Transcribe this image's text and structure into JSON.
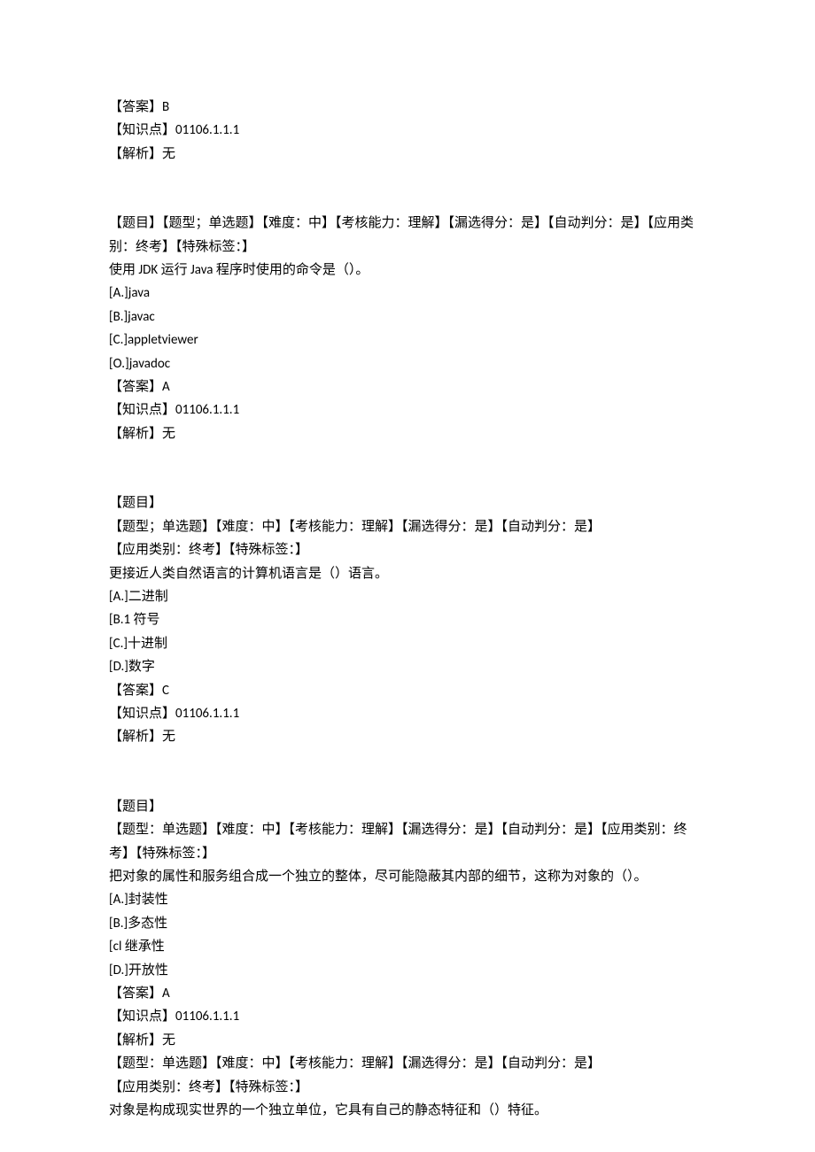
{
  "block1": {
    "answer_label": "【答案】",
    "answer_value": "B",
    "kp_label": "【知识点】",
    "kp_value": "01106.1.1.1",
    "exp_label": "【解析】",
    "exp_value": "无"
  },
  "block2": {
    "header": "【题目】【题型；单选题】【难度：中】【考核能力：理解】【漏选得分：是】【自动判分：是】【应用类别：终考】【特殊标签：】",
    "stem": "使用 JDK 运行 Java 程序时使用的命令是（）。",
    "optA": "[A.]java",
    "optB": "[B.]javac",
    "optC": "[C.]appletviewer",
    "optD": "[O.]javadoc",
    "answer_label": "【答案】",
    "answer_value": "A",
    "kp_label": "【知识点】",
    "kp_value": "01106.1.1.1",
    "exp_label": "【解析】",
    "exp_value": "无"
  },
  "block3": {
    "title": "【题目】",
    "tags1": "【题型；单选题】【难度：中】【考核能力：理解】【漏选得分：是】【自动判分：是】",
    "tags2": "【应用类别：终考】【特殊标签：】",
    "stem": "更接近人类自然语言的计算机语言是（）语言。",
    "optA": "[A.]二进制",
    "optB": "[B.1 符号",
    "optC": "[C.]十进制",
    "optD": "[D.]数字",
    "answer_label": "【答案】",
    "answer_value": "C",
    "kp_label": "【知识点】",
    "kp_value": "01106.1.1.1",
    "exp_label": "【解析】",
    "exp_value": "无"
  },
  "block4": {
    "title": "【题目】",
    "tags": "【题型：单选题】【难度：中】【考核能力：理解】【漏选得分：是】【自动判分：是】【应用类别：终考】【特殊标签：】",
    "stem": "把对象的属性和服务组合成一个独立的整体，尽可能隐蔽其内部的细节，这称为对象的（）。",
    "optA": "[A.]封装性",
    "optB": "[B.]多态性",
    "optC": "[cl 继承性",
    "optD": "[D.]开放性",
    "answer_label": "【答案】",
    "answer_value": "A",
    "kp_label": "【知识点】",
    "kp_value": "01106.1.1.1",
    "exp_label": "【解析】",
    "exp_value": "无"
  },
  "block5": {
    "tags1": "【题型：单选题】【难度：中】【考核能力：理解】【漏选得分：是】【自动判分：是】",
    "tags2": "【应用类别：终考】【特殊标签：】",
    "stem": "对象是构成现实世界的一个独立单位，它具有自己的静态特征和（）特征。"
  }
}
